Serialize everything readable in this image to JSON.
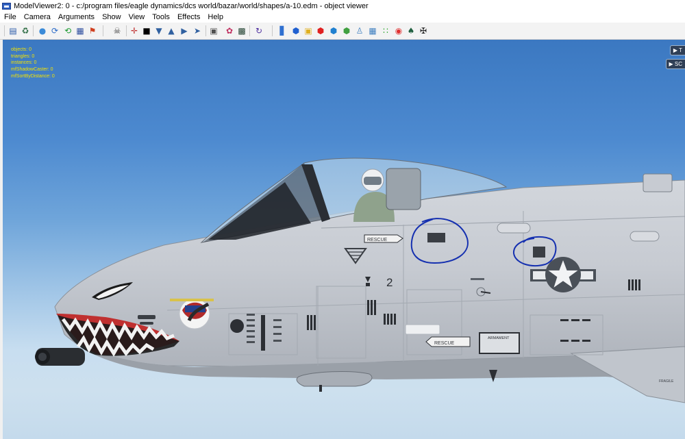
{
  "window": {
    "title": "ModelViewer2: 0 - c:/program files/eagle dynamics/dcs world/bazar/world/shapes/a-10.edm - object viewer"
  },
  "menu": {
    "items": [
      {
        "label": "File"
      },
      {
        "label": "Camera"
      },
      {
        "label": "Arguments"
      },
      {
        "label": "Show"
      },
      {
        "label": "View"
      },
      {
        "label": "Tools"
      },
      {
        "label": "Effects"
      },
      {
        "label": "Help"
      }
    ]
  },
  "toolbar": {
    "icons": [
      "open-file-icon",
      "reload-model-icon",
      "sphere-view-icon",
      "orbit-camera-icon",
      "refresh-green-icon",
      "texture-grid-icon",
      "running-man-icon",
      "skull-icon",
      "crosshair-icon",
      "black-square-icon",
      "funnel-icon",
      "person-cone-icon",
      "fish-icon",
      "fish-arrow-icon",
      "portrait-icon",
      "color-bubbles-icon",
      "monitor-icon",
      "rotate-arrow-icon",
      "bar-chart-icon",
      "blue-cube-icon",
      "gold-cube-icon",
      "red-cube-icon",
      "blue-box-icon",
      "green-pyramid-icon",
      "wireframe-man-icon",
      "grid-outline-icon",
      "green-dots-icon",
      "red-target-icon",
      "tree-icon",
      "person-arms-icon"
    ]
  },
  "overlay": {
    "stats": [
      {
        "label": "objects",
        "value": "0"
      },
      {
        "label": "triangles",
        "value": "0"
      },
      {
        "label": "instances",
        "value": "0"
      },
      {
        "label": "mfShadowCaster",
        "value": "0"
      },
      {
        "label": "mfSortByDistance",
        "value": "0"
      }
    ],
    "side_buttons": [
      {
        "label": "T"
      },
      {
        "label": "SC"
      }
    ]
  },
  "scene": {
    "fuselage_labels": {
      "rescue_1": "RESCUE",
      "rescue_2": "RESCUE",
      "armament": "ARMAMENT",
      "number": "2"
    }
  },
  "colors": {
    "stats_text": "#f5e300",
    "annotation_circle": "#1530b0",
    "sky_top": "#3b78c1",
    "sky_bottom": "#cde0ee"
  }
}
